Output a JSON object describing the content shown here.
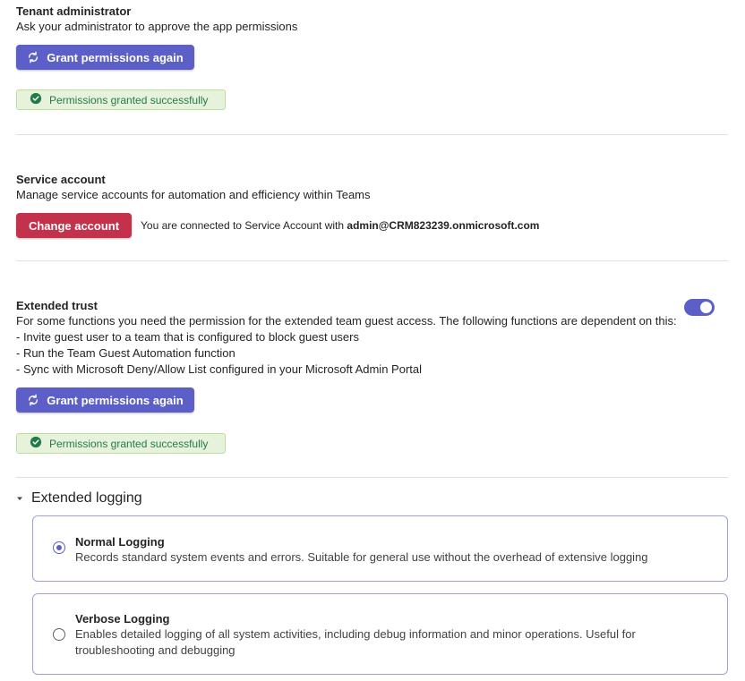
{
  "tenant": {
    "title": "Tenant administrator",
    "description": "Ask your administrator to approve the app permissions",
    "button_label": "Grant permissions again",
    "status": "Permissions granted successfully"
  },
  "service_account": {
    "title": "Service account",
    "description": "Manage service accounts for automation and efficiency within Teams",
    "button_label": "Change account",
    "connected_text": "You are connected to Service Account with",
    "account_email": "admin@CRM823239.onmicrosoft.com"
  },
  "extended_trust": {
    "title": "Extended trust",
    "description": "For some functions you need the permission for the extended team guest access. The following functions are dependent on this:",
    "items": [
      "- Invite guest user to a team that is configured to block guest users",
      "- Run the Team Guest Automation function",
      "- Sync with Microsoft Deny/Allow List configured in your Microsoft Admin Portal"
    ],
    "toggle_on": true,
    "button_label": "Grant permissions again",
    "status": "Permissions granted successfully"
  },
  "extended_logging": {
    "title": "Extended logging",
    "options": [
      {
        "title": "Normal Logging",
        "description": "Records standard system events and errors. Suitable for general use without the overhead of extensive logging",
        "selected": true
      },
      {
        "title": "Verbose Logging",
        "description": "Enables detailed logging of all system activities, including debug information and minor operations. Useful for troubleshooting and debugging",
        "selected": false
      }
    ]
  },
  "colors": {
    "brand": "#5b5fc7",
    "danger": "#c4314b",
    "success_bg": "#e7f2da",
    "success_text": "#237b4b"
  }
}
